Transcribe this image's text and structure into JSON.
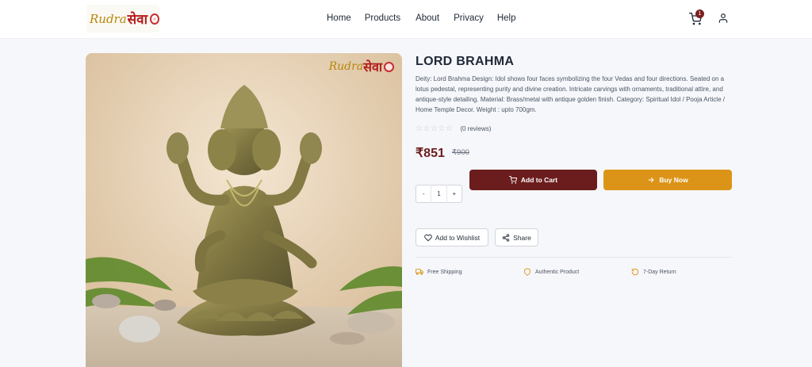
{
  "brand": {
    "logo_text_a": "Rudra",
    "logo_text_b": "सेवा"
  },
  "nav": {
    "items": [
      "Home",
      "Products",
      "About",
      "Privacy",
      "Help"
    ]
  },
  "header": {
    "cart_count": "1"
  },
  "product": {
    "title": "LORD BRAHMA",
    "description": "Deity: Lord Brahma Design: Idol shows four faces symbolizing the four Vedas and four directions. Seated on a lotus pedestal, representing purity and divine creation. Intricate carvings with ornaments, traditional attire, and antique-style detailing. Material: Brass/metal with antique golden finish. Category: Spiritual Idol / Pooja Article / Home Temple Decor. Weight : upto 700gm.",
    "rating_stars": "☆☆☆☆☆",
    "reviews": "(0 reviews)",
    "price": "₹851",
    "old_price": "₹900",
    "quantity": {
      "minus": "-",
      "value": "1",
      "plus": "+"
    }
  },
  "actions": {
    "add_to_cart": "Add to Cart",
    "buy_now": "Buy Now",
    "wishlist": "Add to Wishlist",
    "share": "Share"
  },
  "features": [
    "Free Shipping",
    "Authentic Product",
    "7-Day Return"
  ],
  "colors": {
    "primary": "#6b1d1d",
    "accent": "#dc9418"
  }
}
